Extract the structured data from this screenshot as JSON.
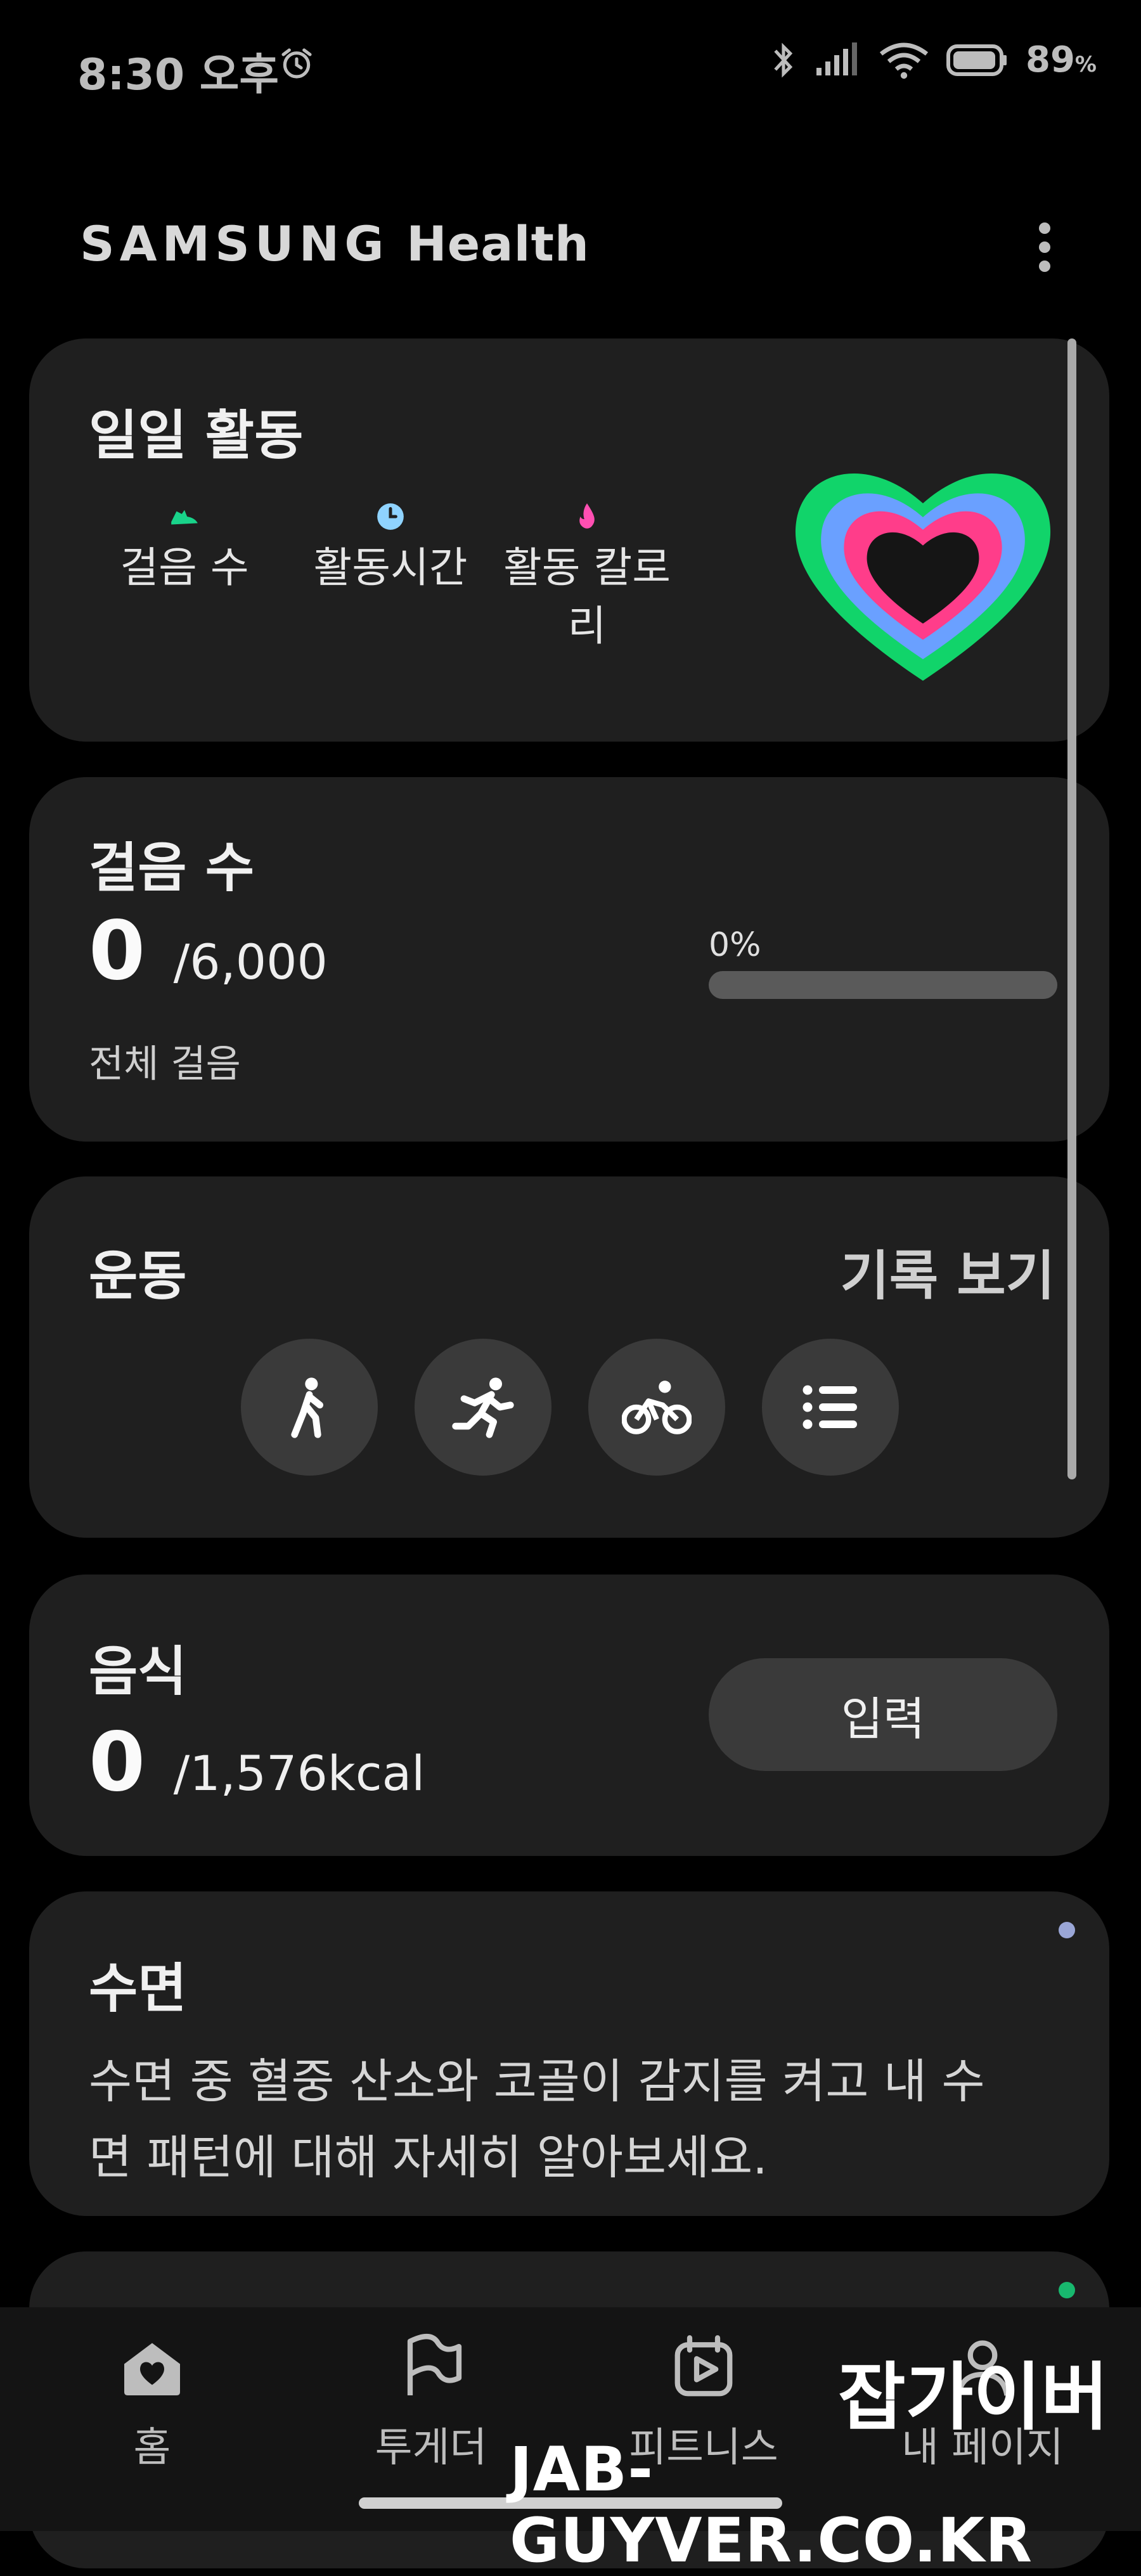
{
  "status_bar": {
    "time": "8:30 오후",
    "battery": "89",
    "battery_unit": "%"
  },
  "header": {
    "app_brand": "SAMSUNG",
    "app_name": "Health"
  },
  "daily_activity": {
    "title": "일일 활동",
    "metrics": [
      {
        "label": "걸음 수",
        "icon": "shoe-icon",
        "color": "#19d38a"
      },
      {
        "label": "활동시간",
        "icon": "clock-icon",
        "color": "#8fd3ff"
      },
      {
        "label_line1": "활동 칼로",
        "label_line2": "리",
        "icon": "flame-icon",
        "color": "#ff4fb2"
      }
    ],
    "ring_colors": {
      "outer": "#11d46a",
      "middle": "#6aa0ff",
      "inner": "#ff3d8a"
    }
  },
  "steps": {
    "title": "걸음 수",
    "value": "0",
    "goal": "/6,000",
    "sub_label": "전체 걸음",
    "progress_text": "0%",
    "progress": 0
  },
  "exercise": {
    "title": "운동",
    "history_link": "기록 보기",
    "buttons": [
      "walk-icon",
      "run-icon",
      "bike-icon",
      "list-icon"
    ]
  },
  "food": {
    "title": "음식",
    "value": "0",
    "goal": "/1,576kcal",
    "input_label": "입력"
  },
  "sleep": {
    "title": "수면",
    "description_line1": "수면 중 혈중 산소와 코골이 감지를 켜고 내 수",
    "description_line2": "면 패턴에 대해 자세히 알아보세요.",
    "dot_color": "#9aa6d6"
  },
  "next_card": {
    "dot_color": "#18b86e"
  },
  "bottom_nav": {
    "items": [
      {
        "label": "홈",
        "icon": "home-icon"
      },
      {
        "label": "투게더",
        "icon": "flag-icon"
      },
      {
        "label": "피트니스",
        "icon": "fitness-play-icon"
      },
      {
        "label": "내 페이지",
        "icon": "person-icon"
      }
    ]
  },
  "watermark": {
    "korean": "잡가이버",
    "url": "JAB-GUYVER.CO.KR"
  }
}
